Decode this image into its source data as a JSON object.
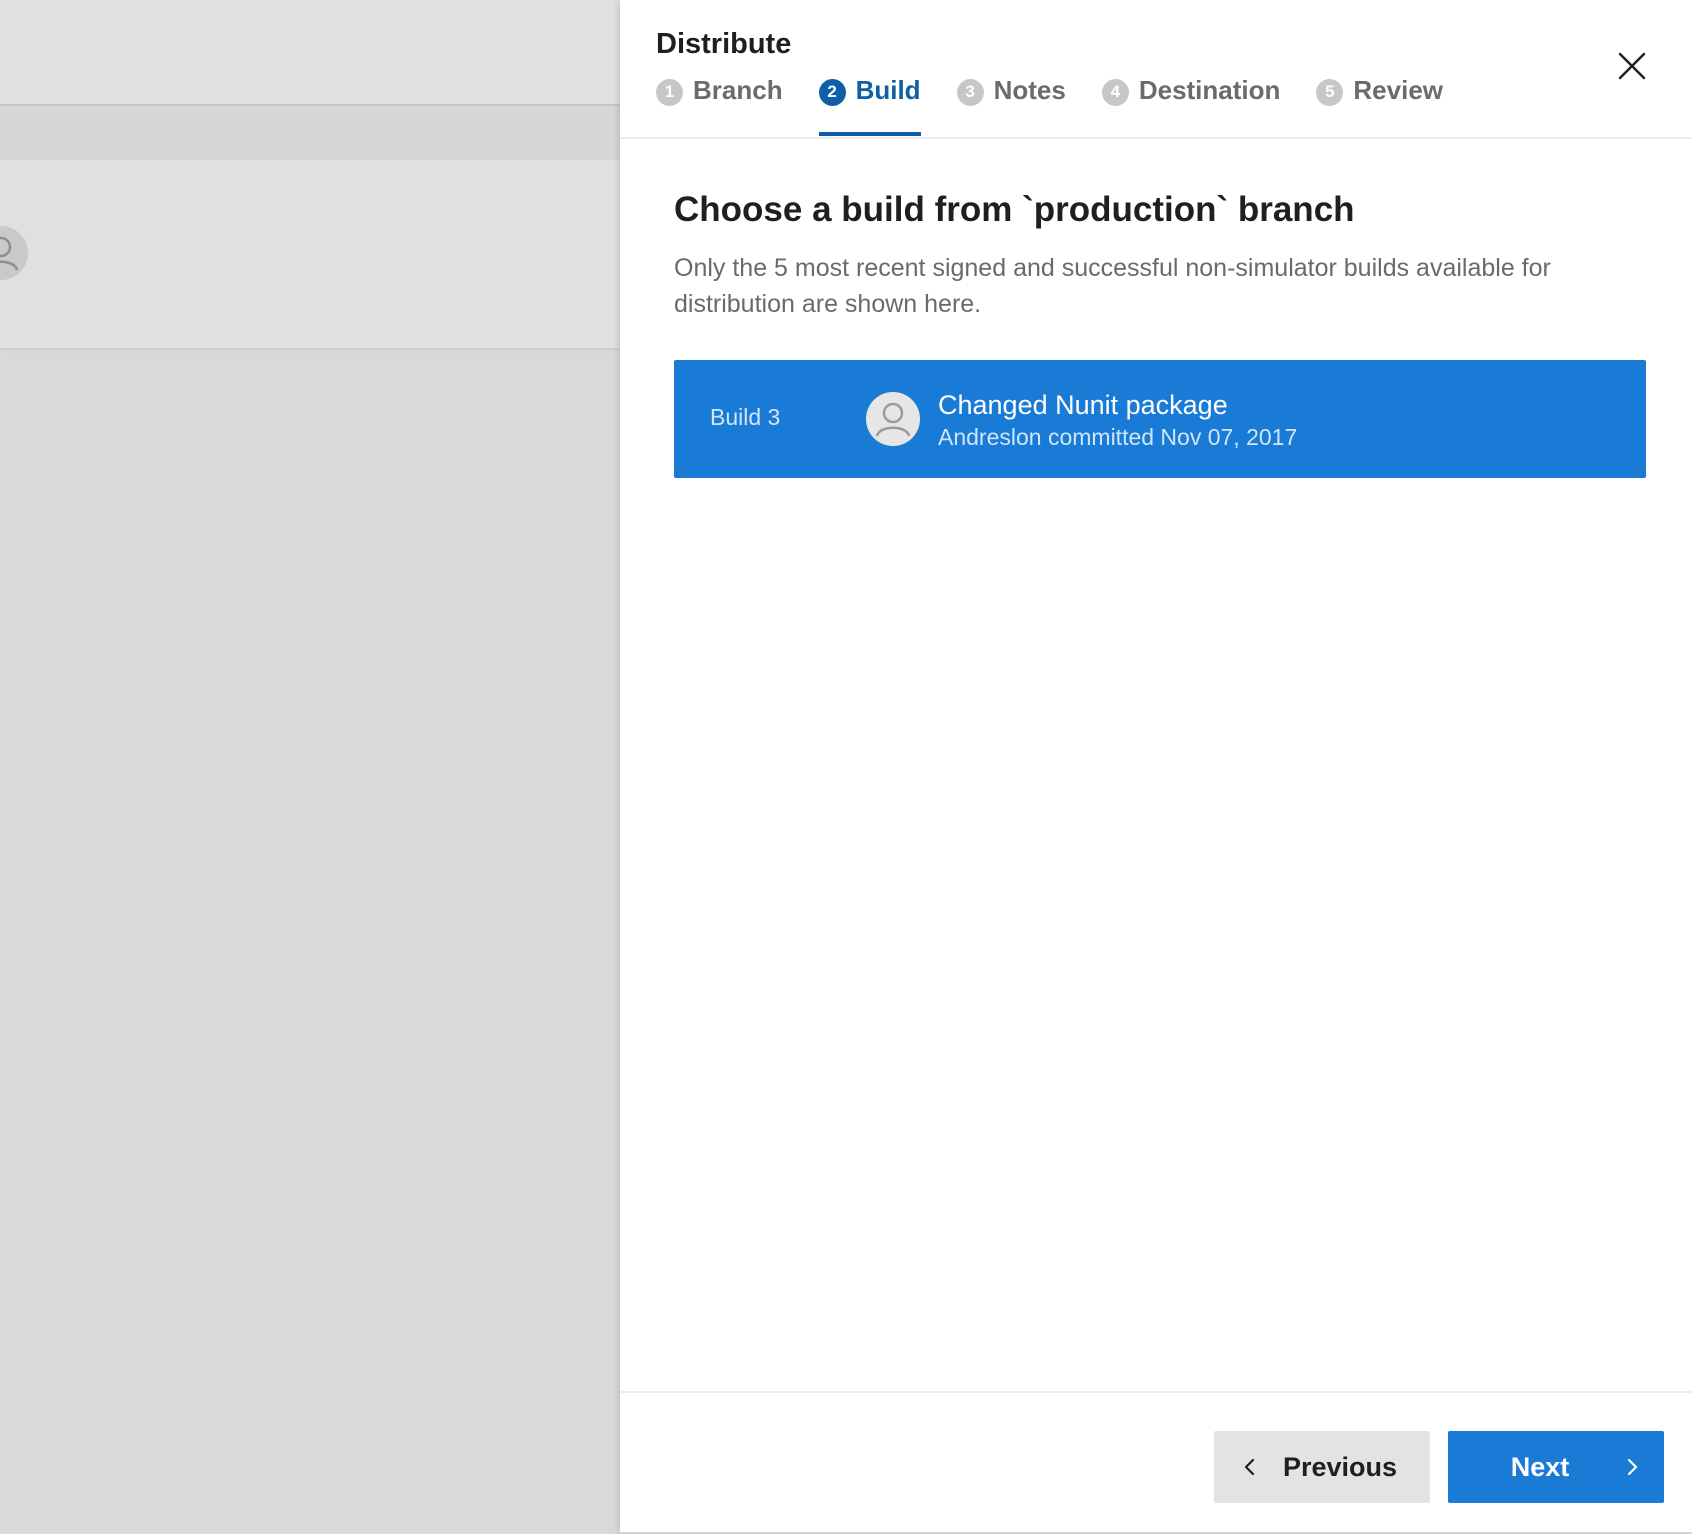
{
  "panel": {
    "title": "Distribute",
    "steps": [
      {
        "number": "1",
        "label": "Branch",
        "active": false
      },
      {
        "number": "2",
        "label": "Build",
        "active": true
      },
      {
        "number": "3",
        "label": "Notes",
        "active": false
      },
      {
        "number": "4",
        "label": "Destination",
        "active": false
      },
      {
        "number": "5",
        "label": "Review",
        "active": false
      }
    ],
    "close_icon": "close-icon"
  },
  "content": {
    "title": "Choose a build from `production` branch",
    "description": "Only the 5 most recent signed and successful non-simulator builds available for distribution are shown here."
  },
  "builds": [
    {
      "label": "Build 3",
      "commit_message": "Changed Nunit package",
      "commit_meta": "Andreslon committed Nov 07, 2017",
      "avatar_icon": "user-avatar-icon",
      "selected": true
    }
  ],
  "footer": {
    "previous_label": "Previous",
    "next_label": "Next"
  },
  "colors": {
    "accent": "#1a7bd6",
    "active_step": "#0f5fa8",
    "inactive_step": "#c7c7c7"
  }
}
